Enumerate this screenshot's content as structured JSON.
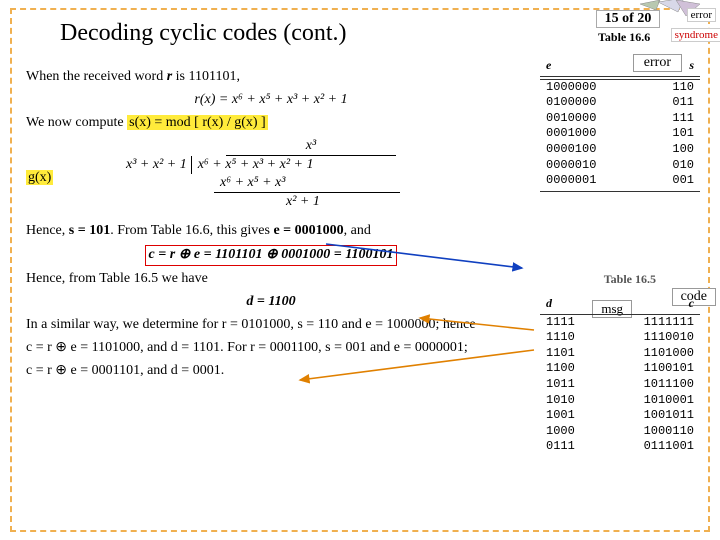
{
  "title": "Decoding cyclic codes (cont.)",
  "page_indicator": "15 of 20",
  "tags": {
    "error_small": "error",
    "syndrome_small": "syndrome",
    "error_box": "error",
    "code_box": "code",
    "msg_box": "msg"
  },
  "table166": {
    "label": "Table 16.6",
    "headers": {
      "e": "e",
      "s": "s"
    },
    "rows": [
      {
        "e": "1000000",
        "s": "110"
      },
      {
        "e": "0100000",
        "s": "011"
      },
      {
        "e": "0010000",
        "s": "111"
      },
      {
        "e": "0001000",
        "s": "101"
      },
      {
        "e": "0000100",
        "s": "100"
      },
      {
        "e": "0000010",
        "s": "010"
      },
      {
        "e": "0000001",
        "s": "001"
      }
    ]
  },
  "table165": {
    "label": "Table 16.5",
    "headers": {
      "d": "d",
      "c": "c"
    },
    "rows": [
      {
        "d": "1111",
        "c": "1111111"
      },
      {
        "d": "1110",
        "c": "1110010"
      },
      {
        "d": "1101",
        "c": "1101000"
      },
      {
        "d": "1100",
        "c": "1100101"
      },
      {
        "d": "1011",
        "c": "1011100"
      },
      {
        "d": "1010",
        "c": "1010001"
      },
      {
        "d": "1001",
        "c": "1001011"
      },
      {
        "d": "1000",
        "c": "1000110"
      },
      {
        "d": "0111",
        "c": "0111001"
      }
    ]
  },
  "body": {
    "line1_pre": "When the received word ",
    "line1_r": "r",
    "line1_post": " is 1101101,",
    "rx_formula": "r(x) = x⁶ + x⁵ + x³ + x² + 1",
    "compute_pre": "We now compute ",
    "compute_hl": "s(x) = mod [ r(x) / g(x) ]",
    "gx_label": "g(x)",
    "longdiv": {
      "quotient": "x³",
      "divisor": "x³ + x² + 1",
      "dividend": "x⁶ + x⁵ + x³ + x² + 1",
      "step1": "x⁶ + x⁵ + x³",
      "remainder": "x² + 1"
    },
    "hence1_pre": "Hence, ",
    "hence1_s": "s = 101",
    "hence1_mid": ". From Table 16.6, this gives ",
    "hence1_e": "e = 0001000",
    "hence1_post": ", and",
    "c_formula": "c = r ⊕ e = 1101101 ⊕ 0001000 = 1100101",
    "hence2": "Hence, from Table 16.5 we have",
    "d_formula": "d = 1100",
    "similar_l1": "In a similar way, we determine for r = 0101000, s = 110 and e = 1000000; hence",
    "similar_l2": "c = r ⊕ e = 1101000, and d = 1101. For r = 0001100, s = 001 and e = 0000001;",
    "similar_l3": "c = r ⊕ e = 0001101, and d = 0001."
  }
}
